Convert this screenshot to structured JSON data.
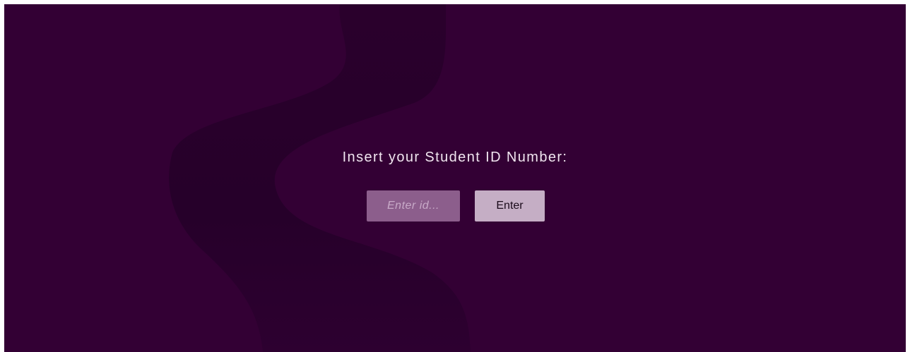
{
  "login": {
    "prompt": "Insert your Student ID Number:",
    "id_placeholder": "Enter id...",
    "id_value": "",
    "enter_label": "Enter"
  },
  "colors": {
    "background": "#330034",
    "wave": "#28002a",
    "input_bg": "#8c5e8c",
    "button_bg": "#c5aec5"
  },
  "icons": {
    "decoration": "s-curve-wave"
  }
}
